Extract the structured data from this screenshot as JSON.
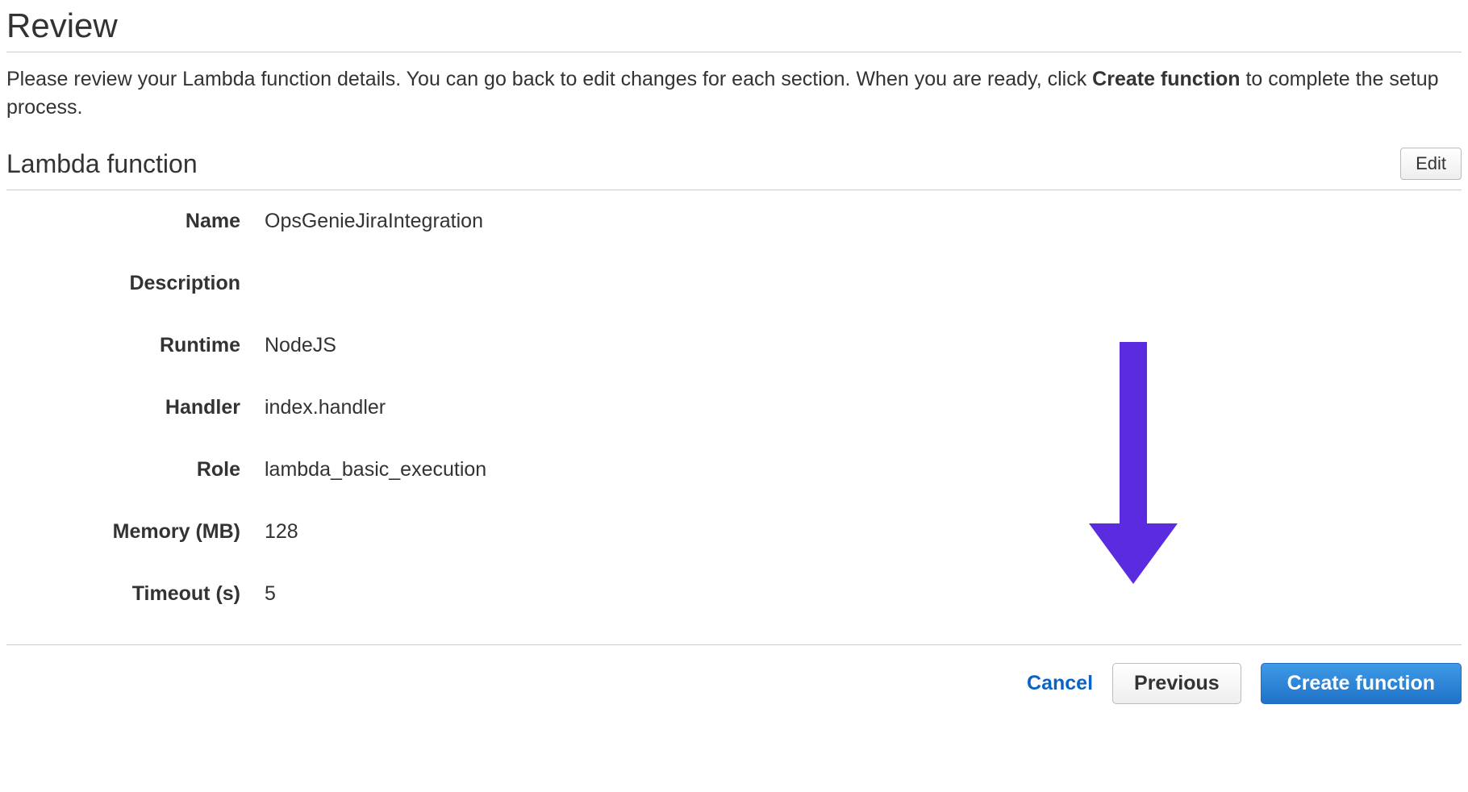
{
  "page": {
    "title": "Review",
    "intro_before": "Please review your Lambda function details. You can go back to edit changes for each section. When you are ready, click ",
    "intro_bold": "Create function",
    "intro_after": " to complete the setup process."
  },
  "section": {
    "title": "Lambda function",
    "edit_label": "Edit"
  },
  "fields": {
    "name_label": "Name",
    "name_value": "OpsGenieJiraIntegration",
    "description_label": "Description",
    "description_value": "",
    "runtime_label": "Runtime",
    "runtime_value": "NodeJS",
    "handler_label": "Handler",
    "handler_value": "index.handler",
    "role_label": "Role",
    "role_value": "lambda_basic_execution",
    "memory_label": "Memory (MB)",
    "memory_value": "128",
    "timeout_label": "Timeout (s)",
    "timeout_value": "5"
  },
  "footer": {
    "cancel": "Cancel",
    "previous": "Previous",
    "create": "Create function"
  },
  "annotation": {
    "arrow_color": "#5b2be0"
  }
}
